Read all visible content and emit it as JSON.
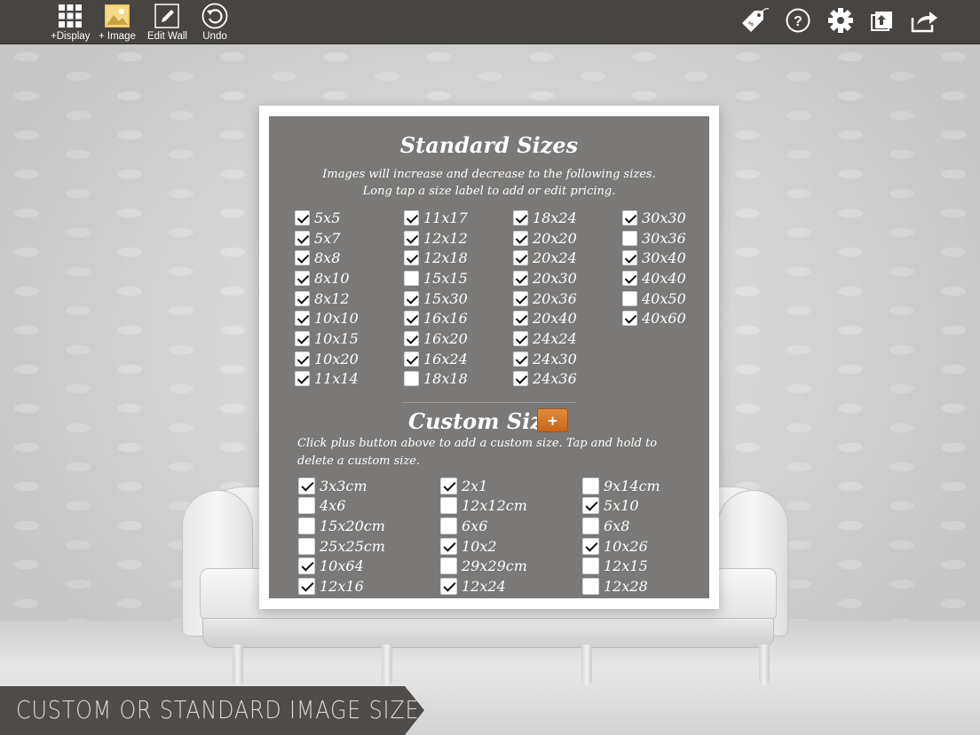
{
  "toolbar": {
    "left_buttons": [
      {
        "label": "+Display",
        "icon": "grid-icon"
      },
      {
        "label": "+ Image",
        "icon": "image-icon"
      },
      {
        "label": "Edit Wall",
        "icon": "pencil-icon"
      },
      {
        "label": "Undo",
        "icon": "undo-icon"
      }
    ],
    "right_buttons": [
      {
        "icon": "price-tag-icon"
      },
      {
        "icon": "help-icon"
      },
      {
        "icon": "gear-icon"
      },
      {
        "icon": "folder-icon"
      },
      {
        "icon": "share-icon"
      }
    ]
  },
  "standard": {
    "title": "Standard Sizes",
    "desc_line1": "Images will increase and decrease to the following sizes.",
    "desc_line2": "Long tap a size label to add or edit pricing.",
    "columns": [
      [
        {
          "label": "5x5",
          "checked": true
        },
        {
          "label": "5x7",
          "checked": true
        },
        {
          "label": "8x8",
          "checked": true
        },
        {
          "label": "8x10",
          "checked": true
        },
        {
          "label": "8x12",
          "checked": true
        },
        {
          "label": "10x10",
          "checked": true
        },
        {
          "label": "10x15",
          "checked": true
        },
        {
          "label": "10x20",
          "checked": true
        },
        {
          "label": "11x14",
          "checked": true
        }
      ],
      [
        {
          "label": "11x17",
          "checked": true
        },
        {
          "label": "12x12",
          "checked": true
        },
        {
          "label": "12x18",
          "checked": true
        },
        {
          "label": "15x15",
          "checked": false
        },
        {
          "label": "15x30",
          "checked": true
        },
        {
          "label": "16x16",
          "checked": true
        },
        {
          "label": "16x20",
          "checked": true
        },
        {
          "label": "16x24",
          "checked": true
        },
        {
          "label": "18x18",
          "checked": false
        }
      ],
      [
        {
          "label": "18x24",
          "checked": true
        },
        {
          "label": "20x20",
          "checked": true
        },
        {
          "label": "20x24",
          "checked": true
        },
        {
          "label": "20x30",
          "checked": true
        },
        {
          "label": "20x36",
          "checked": true
        },
        {
          "label": "20x40",
          "checked": true
        },
        {
          "label": "24x24",
          "checked": true
        },
        {
          "label": "24x30",
          "checked": true
        },
        {
          "label": "24x36",
          "checked": true
        }
      ],
      [
        {
          "label": "30x30",
          "checked": true
        },
        {
          "label": "30x36",
          "checked": false
        },
        {
          "label": "30x40",
          "checked": true
        },
        {
          "label": "40x40",
          "checked": true
        },
        {
          "label": "40x50",
          "checked": false
        },
        {
          "label": "40x60",
          "checked": true
        }
      ]
    ]
  },
  "custom": {
    "title": "Custom Sizes",
    "plus_label": "+",
    "desc": "Click plus button above to add a custom size. Tap and hold to delete a custom size.",
    "columns": [
      [
        {
          "label": "3x3cm",
          "checked": true
        },
        {
          "label": "4x6",
          "checked": false
        },
        {
          "label": "15x20cm",
          "checked": false
        },
        {
          "label": "25x25cm",
          "checked": false
        },
        {
          "label": "10x64",
          "checked": true
        },
        {
          "label": "12x16",
          "checked": true
        }
      ],
      [
        {
          "label": "2x1",
          "checked": true
        },
        {
          "label": "12x12cm",
          "checked": false
        },
        {
          "label": "6x6",
          "checked": false
        },
        {
          "label": "10x2",
          "checked": true
        },
        {
          "label": "29x29cm",
          "checked": false
        },
        {
          "label": "12x24",
          "checked": true
        }
      ],
      [
        {
          "label": "9x14cm",
          "checked": false
        },
        {
          "label": "5x10",
          "checked": true
        },
        {
          "label": "6x8",
          "checked": false
        },
        {
          "label": "10x26",
          "checked": true
        },
        {
          "label": "12x15",
          "checked": false
        },
        {
          "label": "12x28",
          "checked": false
        }
      ]
    ]
  },
  "banner": {
    "text": "CUSTOM OR STANDARD IMAGE SIZES"
  },
  "colors": {
    "toolbar_bg": "#474441",
    "panel_bg": "#7b7977",
    "accent_orange": "#d9772a",
    "banner_bg": "#4f4c49"
  }
}
